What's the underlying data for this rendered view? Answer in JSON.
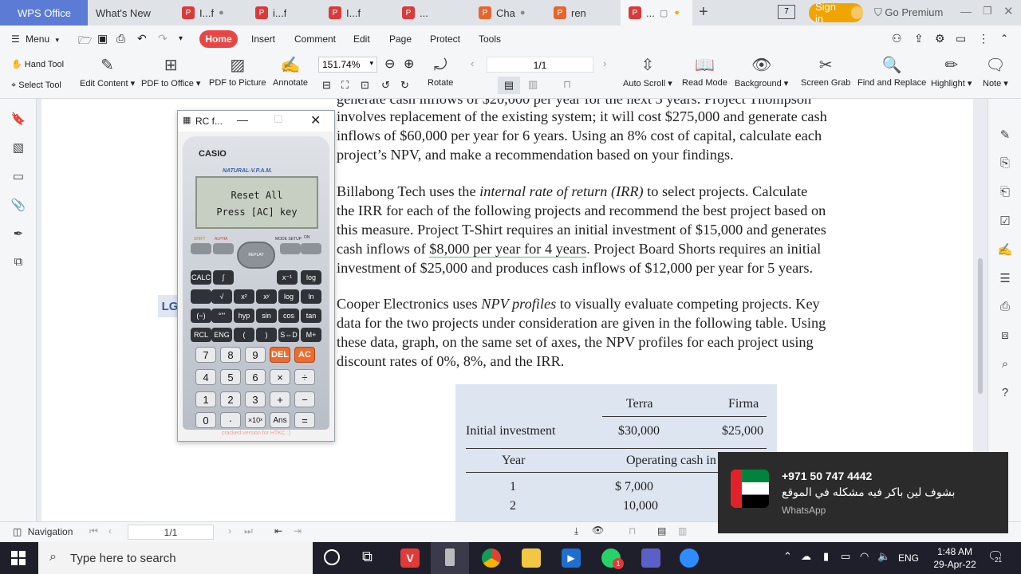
{
  "tabs": {
    "wps": "WPS Office",
    "whats_new": "What's New",
    "t1": "I...f",
    "t2": "i...f",
    "t3": "I...f",
    "t4": "...",
    "t5": "Cha",
    "t6": "ren",
    "t7": "...",
    "sign_in": "Sign in",
    "go_premium": "Go Premium"
  },
  "menu": {
    "menu_label": "Menu",
    "home": "Home",
    "insert": "Insert",
    "comment": "Comment",
    "edit": "Edit",
    "page": "Page",
    "protect": "Protect",
    "tools": "Tools"
  },
  "toolbar": {
    "hand_tool": "Hand Tool",
    "select_tool": "Select Tool",
    "edit_content": "Edit Content",
    "pdf_to_office": "PDF to Office",
    "pdf_to_picture": "PDF to Picture",
    "annotate": "Annotate",
    "zoom": "151.74%",
    "page_counter": "1/1",
    "rotate": "Rotate",
    "auto_scroll": "Auto Scroll",
    "read_mode": "Read Mode",
    "background": "Background",
    "screen_grab": "Screen Grab",
    "find_replace": "Find and Replace",
    "highlight": "Highlight",
    "note": "Note"
  },
  "document": {
    "lines": [
      "generate cash inflows of $20,000 per year for the next 5 years. Project Thompson",
      "involves replacement of the existing system; it will cost $275,000 and generate cash",
      "inflows of $60,000 per year for 6 years. Using an 8% cost of capital, calculate each",
      "project’s NPV, and make a recommendation based on your findings."
    ],
    "p2_a": "Billabong Tech uses the ",
    "p2_irr": "internal rate of return (IRR)",
    "p2_b": " to select projects. Calculate",
    "p2_l2": "the IRR for each of the following projects and recommend the best project based on",
    "p2_l3": "this measure. Project T-Shirt requires an initial investment of $15,000 and generates",
    "p2_l4a": "cash inflows of ",
    "p2_l4u": "$8,000 per year for 4 years",
    "p2_l4b": ". Project Board Shorts requires an initial",
    "p2_l5": "investment of $25,000 and produces cash inflows of $12,000 per year for 5 years.",
    "lg": "LG",
    "p3_a": "Cooper Electronics uses ",
    "p3_npv": "NPV profiles",
    "p3_b": " to visually evaluate competing projects. Key",
    "p3_l2": "data for the two projects under consideration are given in the following table. Using",
    "p3_l3": "these data, graph, on the same set of axes, the NPV profiles for each project using",
    "p3_l4": "discount rates of 0%, 8%, and the IRR.",
    "table": {
      "col1": "Terra",
      "col2": "Firma",
      "row_invest": "Initial investment",
      "invest1": "$30,000",
      "invest2": "$25,000",
      "year": "Year",
      "op_cash": "Operating cash in",
      "y1": "1",
      "y1v": "$  7,000",
      "y2": "2",
      "y2v": "10,000"
    }
  },
  "calculator": {
    "title": "RC f...",
    "brand": "CASIO",
    "model": "NATURAL-V.P.A.M.",
    "screen1": "Reset All",
    "screen2": "Press [AC] key",
    "footer": "cracked version for HTKC :)",
    "keys_row1": [
      "7",
      "8",
      "9",
      "DEL",
      "AC"
    ],
    "keys_row2": [
      "4",
      "5",
      "6",
      "×",
      "÷"
    ],
    "keys_row3": [
      "1",
      "2",
      "3",
      "+",
      "−"
    ],
    "keys_row4": [
      "0",
      "·",
      "×10ˣ",
      "Ans",
      "="
    ],
    "fn_row1": [
      "CALC",
      "∫",
      "",
      "x⁻¹",
      "log"
    ],
    "fn_row2": [
      "",
      "√",
      "x²",
      "xʸ",
      "log",
      "ln"
    ],
    "fn_row3": [
      "(−)",
      "°'\"",
      "hyp",
      "sin",
      "cos",
      "tan"
    ],
    "fn_row4": [
      "RCL",
      "ENG",
      "(",
      ")",
      "S⇔D",
      "M+"
    ],
    "shift": "SHIFT",
    "alpha": "ALPHA",
    "mode": "MODE SETUP",
    "on": "ON",
    "replay": "REPLAY"
  },
  "navbar": {
    "navigation": "Navigation",
    "page": "1/1"
  },
  "toast": {
    "phone": "+971 50 747 4442",
    "message": "بشوف لين باكر فيه مشكله في الموقع",
    "app": "WhatsApp"
  },
  "taskbar": {
    "search_placeholder": "Type here to search",
    "lang": "ENG",
    "time": "1:48 AM",
    "date": "29-Apr-22",
    "notif": "21",
    "badge": "1"
  }
}
